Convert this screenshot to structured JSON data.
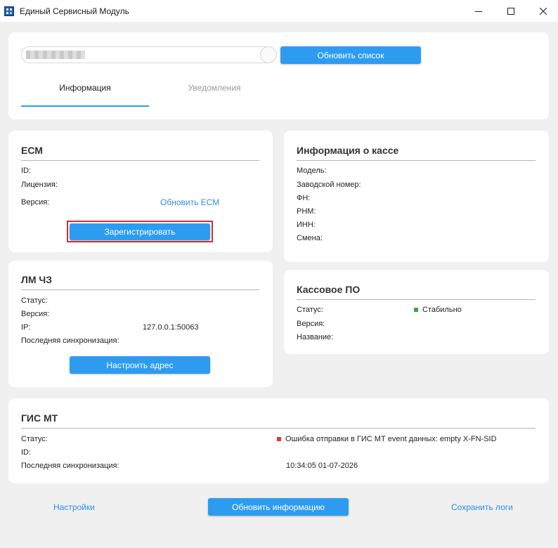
{
  "window": {
    "title": "Единый Сервисный Модуль",
    "minimize": "–",
    "maximize": "□",
    "close": "✕"
  },
  "top": {
    "search_value": "",
    "refresh_list_label": "Обновить список",
    "tabs": [
      {
        "label": "Информация",
        "active": true
      },
      {
        "label": "Уведомления",
        "active": false
      }
    ]
  },
  "ecm": {
    "title": "ЕСМ",
    "id_label": "ID:",
    "license_label": "Лицензия:",
    "version_label": "Версия:",
    "update_link": "Обновить ЕСМ",
    "register_button": "Зарегистрировать"
  },
  "lm": {
    "title": "ЛМ ЧЗ",
    "status_label": "Статус:",
    "version_label": "Версия:",
    "ip_label": "IP:",
    "ip_value": "127.0.0.1:50063",
    "last_sync_label": "Последняя синхронизация:",
    "configure_button": "Настроить адрес"
  },
  "kassa_info": {
    "title": "Информация о кассе",
    "model_label": "Модель:",
    "serial_label": "Заводской номер:",
    "fn_label": "ФН:",
    "rnm_label": "РНМ:",
    "inn_label": "ИНН:",
    "shift_label": "Смена:"
  },
  "kassa_po": {
    "title": "Кассовое ПО",
    "status_label": "Статус:",
    "status_value": "Стабильно",
    "status_color": "#43a047",
    "version_label": "Версия:",
    "name_label": "Название:"
  },
  "gis": {
    "title": "ГИС МТ",
    "status_label": "Статус:",
    "status_value": "Ошибка отправки в ГИС МТ event данных: empty X-FN-SID",
    "status_color": "#e53935",
    "id_label": "ID:",
    "last_sync_label": "Последняя синхронизация:",
    "last_sync_value": "10:34:05 01-07-2026"
  },
  "footer": {
    "settings_link": "Настройки",
    "update_info_button": "Обновить информацию",
    "save_logs_link": "Сохранить логи"
  },
  "colors": {
    "accent": "#2d9cf0",
    "highlight_border": "#d32f2f"
  }
}
